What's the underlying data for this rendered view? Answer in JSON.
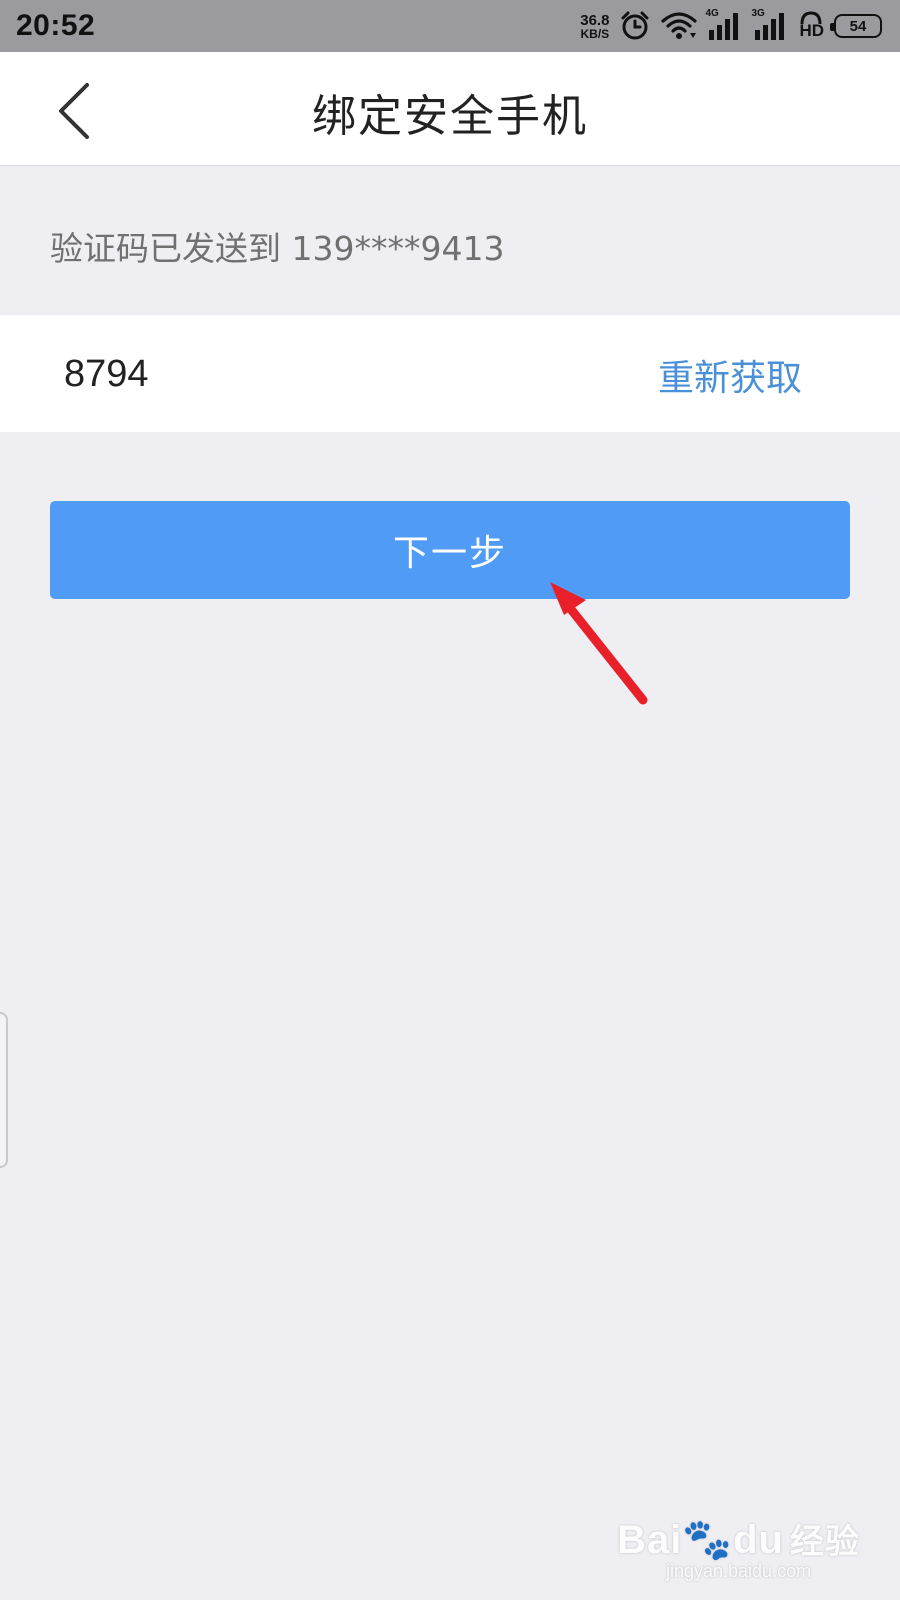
{
  "status_bar": {
    "time": "20:52",
    "net_speed_value": "36.8",
    "net_speed_unit": "KB/S",
    "sim1_tag": "4G",
    "sim2_tag": "3G",
    "hd_label": "HD",
    "battery_level": "54",
    "icons": [
      "alarm-icon",
      "wifi-icon",
      "signal-icon",
      "signal-icon",
      "battery-icon"
    ]
  },
  "header": {
    "title": "绑定安全手机",
    "back_icon": "chevron-left-icon"
  },
  "verification": {
    "info_text": "验证码已发送到 139****9413",
    "code_value": "8794",
    "resend_label": "重新获取"
  },
  "actions": {
    "next_label": "下一步",
    "primary_color": "#4f9bf6",
    "link_color": "#4a90d9"
  },
  "annotation": {
    "arrow_color": "#e8202a"
  },
  "watermark": {
    "brand": "Bai",
    "brand_suffix": "du",
    "brand_cn": "经验",
    "url": "jingyan.baidu.com"
  }
}
